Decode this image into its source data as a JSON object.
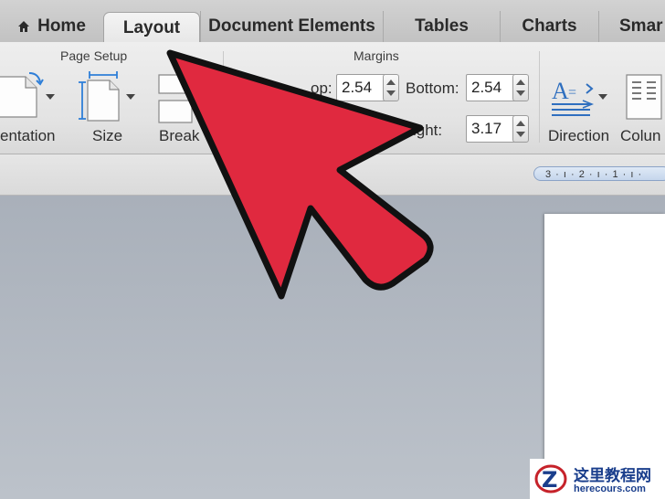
{
  "tabs": [
    {
      "label": "Home",
      "icon": "home-icon",
      "active": false
    },
    {
      "label": "Layout",
      "active": true
    },
    {
      "label": "Document Elements",
      "active": false
    },
    {
      "label": "Tables",
      "active": false
    },
    {
      "label": "Charts",
      "active": false
    },
    {
      "label": "Smar",
      "active": false
    }
  ],
  "ribbon": {
    "page_setup": {
      "title": "Page Setup",
      "buttons": [
        "entation",
        "Size",
        "Break"
      ]
    },
    "margins": {
      "title": "Margins",
      "top_label": "op:",
      "top_value": "2.54",
      "bottom_label": "Bottom:",
      "bottom_value": "2.54",
      "right_label": "ight:",
      "right_value": "3.17"
    },
    "text_layout": {
      "buttons": [
        "Direction",
        "Colun"
      ]
    }
  },
  "ruler": {
    "text": "3 · ı · 2 · ı · 1 · ı ·"
  },
  "watermark": {
    "title": "这里教程网",
    "url": "herecours.com"
  },
  "colors": {
    "arrow_fill": "#e0293f",
    "arrow_stroke": "#111111"
  }
}
